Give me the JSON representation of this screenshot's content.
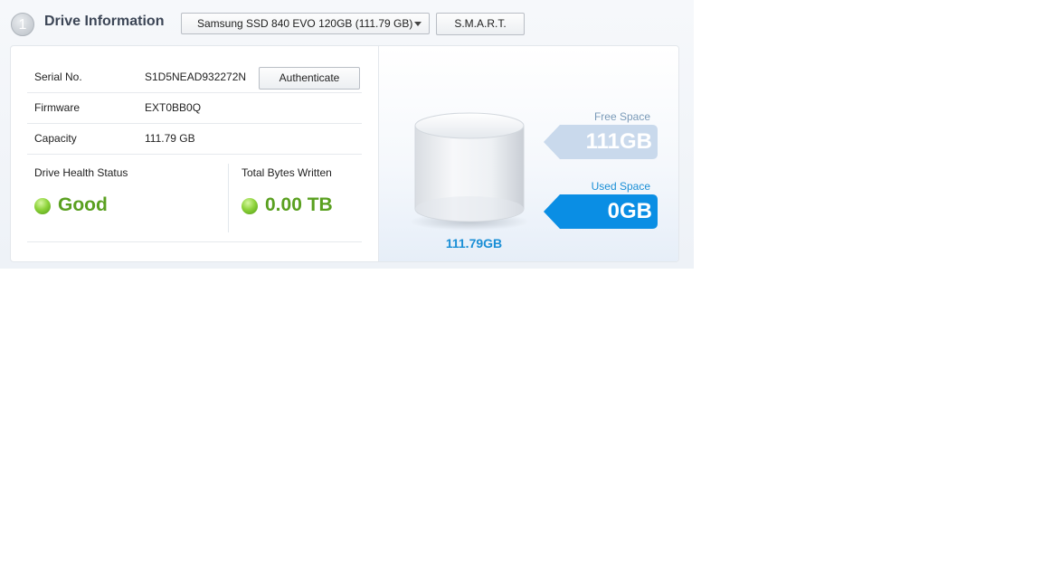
{
  "header": {
    "step_number": "1",
    "title": "Drive Information",
    "drive_select_value": "Samsung SSD 840 EVO 120GB  (111.79 GB)",
    "smart_label": "S.M.A.R.T."
  },
  "details": {
    "serial_label": "Serial No.",
    "serial_value": "S1D5NEAD932272N",
    "authenticate_label": "Authenticate",
    "firmware_label": "Firmware",
    "firmware_value": "EXT0BB0Q",
    "capacity_label": "Capacity",
    "capacity_value": "111.79 GB"
  },
  "status": {
    "health_label": "Drive Health Status",
    "health_value": "Good",
    "tbw_label": "Total Bytes Written",
    "tbw_value": "0.00 TB"
  },
  "graphic": {
    "total_label": "111.79GB",
    "free_label": "Free Space",
    "free_value": "111GB",
    "used_label": "Used Space",
    "used_value": "0GB"
  },
  "colors": {
    "accent_blue": "#0a8ee4",
    "free_tag": "#c9d9ec",
    "good_green": "#5aa020"
  }
}
